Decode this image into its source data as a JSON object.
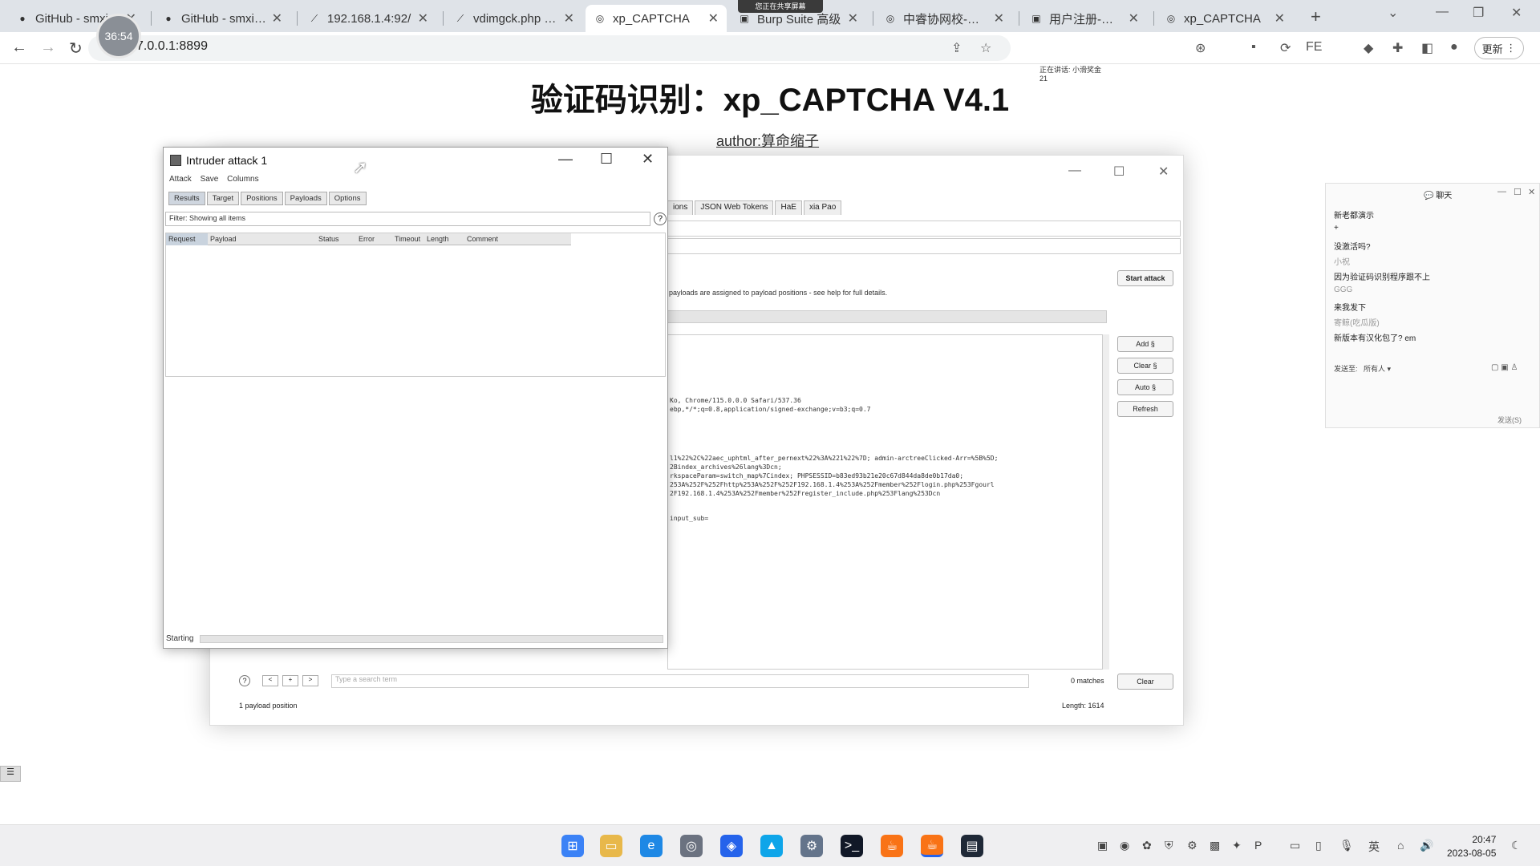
{
  "browser": {
    "tabs": [
      {
        "label": "GitHub - smxi",
        "icon": "github-icon"
      },
      {
        "label": "GitHub - smxiaz",
        "icon": "github-icon"
      },
      {
        "label": "192.168.1.4:92/",
        "icon": "page-icon"
      },
      {
        "label": "vdimgck.php (5(",
        "icon": "page-icon"
      },
      {
        "label": "xp_CAPTCHA",
        "icon": "globe-icon",
        "active": true
      },
      {
        "label": "Burp Suite 高级",
        "icon": "page-icon"
      },
      {
        "label": "中睿协网校-注册",
        "icon": "globe-icon"
      },
      {
        "label": "用户注册-中大网",
        "icon": "page-icon"
      },
      {
        "label": "xp_CAPTCHA",
        "icon": "globe-icon"
      }
    ],
    "share_banner": "您正在共享屏幕",
    "address": "127.0.0.1:8899",
    "address_visible": "7.0.0.1:8899",
    "update_label": "更新",
    "timer": "36:54",
    "mini_popup": {
      "line1": "正在讲话: 小滑奖金",
      "line2": "21"
    }
  },
  "page": {
    "title": "验证码识别：xp_CAPTCHA V4.1",
    "author": "author:算命缩子"
  },
  "burp_main": {
    "tabs": [
      "ions",
      "JSON Web Tokens",
      "HaE",
      "xia Pao"
    ],
    "info_text": "payloads are assigned to payload positions - see help for full details.",
    "buttons": {
      "start_attack": "Start attack",
      "add": "Add §",
      "clear": "Clear §",
      "auto": "Auto §",
      "refresh": "Refresh",
      "clear_search": "Clear"
    },
    "request_lines": [
      "Ko, Chrome/115.0.0.0 Safari/537.36",
      "ebp,*/*;q=0.8,application/signed-exchange;v=b3;q=0.7",
      "",
      "",
      "",
      "l1%22%2C%22aec_uphtml_after_pernext%22%3A%221%22%7D; admin-arctreeClicked-Arr=%5B%5D;",
      "2Bindex_archives%26lang%3Dcn;",
      "rkspaceParam=switch_map%7Cindex; PHPSESSID=b83ed93b21e20c67d844da8de0b17da0;",
      "253A%252F%252Fhttp%253A%252F%252F192.168.1.4%253A%252Fmember%252Flogin.php%253Fgourl",
      "2F192.168.1.4%253A%252Fmember%252Fregister_include.php%253Flang%253Dcn",
      "",
      "input_sub="
    ],
    "search_placeholder": "Type a search term",
    "matches": "0 matches",
    "payload_positions": "1 payload position",
    "length": "Length: 1614"
  },
  "intruder": {
    "title": "Intruder attack 1",
    "menu": [
      "Attack",
      "Save",
      "Columns"
    ],
    "tabs": [
      "Results",
      "Target",
      "Positions",
      "Payloads",
      "Options"
    ],
    "filter": "Filter: Showing all items",
    "columns": [
      "Request",
      "Payload",
      "Status",
      "Error",
      "Timeout",
      "Length",
      "Comment"
    ],
    "status": "Starting",
    "progress_fraction": 0
  },
  "chat": {
    "title": "聊天",
    "messages": [
      {
        "text": "新老都演示",
        "type": "msg"
      },
      {
        "text": "+",
        "type": "msg"
      },
      {
        "text": "没激活吗?",
        "type": "msg"
      },
      {
        "text": "小祝",
        "type": "name"
      },
      {
        "text": "因为验证码识别程序跟不上",
        "type": "msg"
      },
      {
        "text": "GGG",
        "type": "name"
      },
      {
        "text": "来我发下",
        "type": "msg"
      },
      {
        "text": "寄鲸(吃瓜版)",
        "type": "name"
      },
      {
        "text": "新版本有汉化包了? em",
        "type": "msg"
      }
    ],
    "send_to_label": "发送至:",
    "send_to_value": "所有人",
    "send_button": "发送(S)"
  },
  "taskbar": {
    "time": "20:47",
    "date": "2023-08-05",
    "ime": "英"
  },
  "colors": {
    "tabbar_bg": "#dfe3e8",
    "taskbar_bg": "#efeff1",
    "burp_tab_active": "#cfd6df"
  }
}
